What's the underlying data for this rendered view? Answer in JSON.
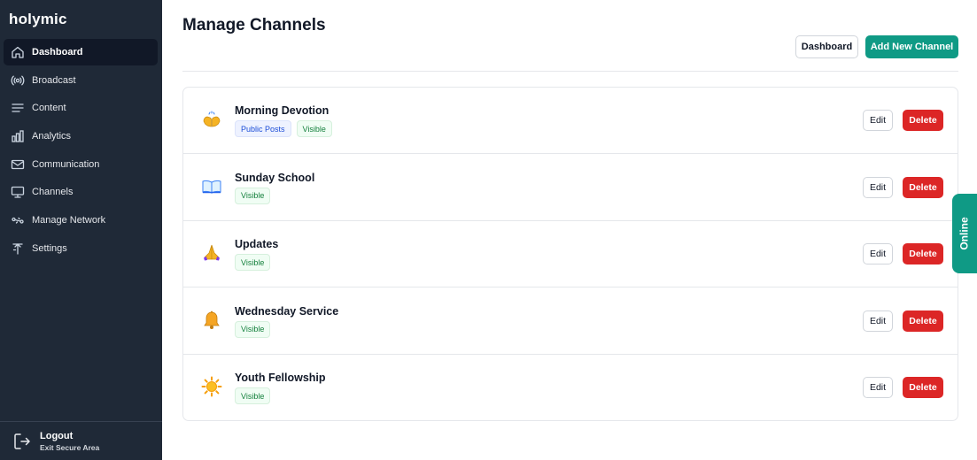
{
  "brand": {
    "name": "holymic"
  },
  "sidebar": {
    "items": [
      {
        "label": "Dashboard",
        "icon": "home-icon"
      },
      {
        "label": "Broadcast",
        "icon": "broadcast-icon"
      },
      {
        "label": "Content",
        "icon": "content-icon"
      },
      {
        "label": "Analytics",
        "icon": "analytics-icon"
      },
      {
        "label": "Communication",
        "icon": "mail-icon"
      },
      {
        "label": "Channels",
        "icon": "monitor-icon"
      },
      {
        "label": "Manage Network",
        "icon": "network-icon"
      },
      {
        "label": "Settings",
        "icon": "settings-icon"
      }
    ],
    "active_index": 0,
    "logout": {
      "label": "Logout",
      "sublabel": "Exit Secure Area"
    }
  },
  "header": {
    "title": "Manage Channels",
    "dashboard_button": "Dashboard",
    "add_button": "Add New Channel"
  },
  "channels": [
    {
      "name": "Morning Devotion",
      "icon": "praying-hands-icon",
      "badges": [
        "Public Posts",
        "Visible"
      ]
    },
    {
      "name": "Sunday School",
      "icon": "open-book-icon",
      "badges": [
        "Visible"
      ]
    },
    {
      "name": "Updates",
      "icon": "folded-hands-icon",
      "badges": [
        "Visible"
      ]
    },
    {
      "name": "Wednesday Service",
      "icon": "bell-icon",
      "badges": [
        "Visible"
      ]
    },
    {
      "name": "Youth Fellowship",
      "icon": "sun-icon",
      "badges": [
        "Visible"
      ]
    }
  ],
  "row_actions": {
    "edit": "Edit",
    "delete": "Delete"
  },
  "status_tab": {
    "label": "Online"
  },
  "colors": {
    "sidebar_bg": "#1f2937",
    "sidebar_active": "#111827",
    "accent": "#0f9a85",
    "danger": "#dc2626",
    "badge_public_bg": "#eef2ff",
    "badge_public_text": "#1d4ed8",
    "badge_visible_bg": "#f0fdf4",
    "badge_visible_text": "#15803d"
  }
}
